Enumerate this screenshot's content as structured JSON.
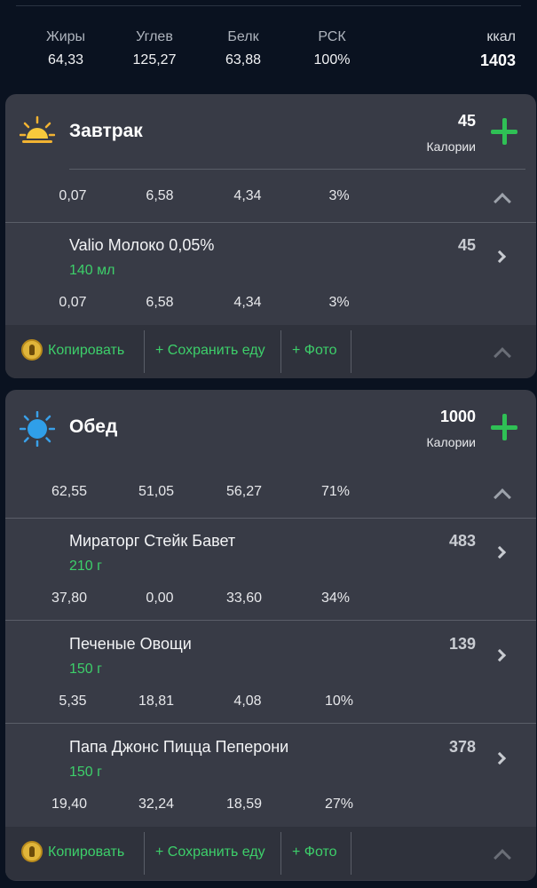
{
  "summary": {
    "columns": [
      {
        "label": "Жиры",
        "value": "64,33"
      },
      {
        "label": "Углев",
        "value": "125,27"
      },
      {
        "label": "Белк",
        "value": "63,88"
      },
      {
        "label": "РСК",
        "value": "100%"
      }
    ],
    "kcal_label": "ккал",
    "kcal_value": "1403"
  },
  "meals": [
    {
      "title": "Завтрак",
      "icon": "sunrise-icon",
      "calories": "45",
      "calories_label": "Калории",
      "macros": [
        "0,07",
        "6,58",
        "4,34",
        "3%"
      ],
      "foods": [
        {
          "name": "Valio Молоко 0,05%",
          "amount": "140 мл",
          "calories": "45",
          "macros": [
            "0,07",
            "6,58",
            "4,34",
            "3%"
          ]
        }
      ]
    },
    {
      "title": "Обед",
      "icon": "sun-icon",
      "calories": "1000",
      "calories_label": "Калории",
      "macros": [
        "62,55",
        "51,05",
        "56,27",
        "71%"
      ],
      "foods": [
        {
          "name": "Мираторг Стейк Бавет",
          "amount": "210 г",
          "calories": "483",
          "macros": [
            "37,80",
            "0,00",
            "33,60",
            "34%"
          ]
        },
        {
          "name": "Печеные Овощи",
          "amount": "150 г",
          "calories": "139",
          "macros": [
            "5,35",
            "18,81",
            "4,08",
            "10%"
          ]
        },
        {
          "name": "Папа Джонс Пицца Пеперони",
          "amount": "150 г",
          "calories": "378",
          "macros": [
            "19,40",
            "32,24",
            "18,59",
            "27%"
          ]
        }
      ]
    }
  ],
  "actions": {
    "copy": "Копировать",
    "save_food": "+ Сохранить еду",
    "photo": "+ Фото"
  },
  "colors": {
    "background": "#0a1220",
    "card": "#383b46",
    "accent_green": "#2fc055"
  }
}
